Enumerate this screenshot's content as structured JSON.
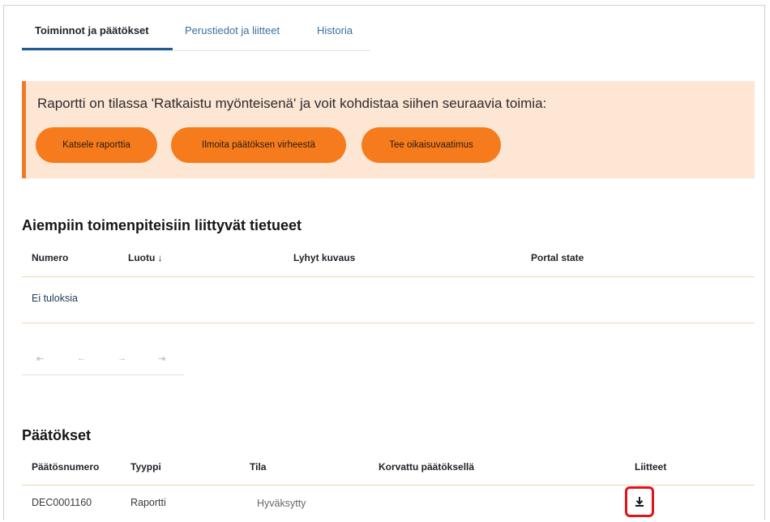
{
  "tabs": [
    {
      "label": "Toiminnot ja päätökset",
      "active": true
    },
    {
      "label": "Perustiedot ja liitteet",
      "active": false
    },
    {
      "label": "Historia",
      "active": false
    }
  ],
  "banner": {
    "text": "Raportti on tilassa 'Ratkaistu myönteisenä' ja voit kohdistaa siihen seuraavia toimia:",
    "buttons": [
      "Katsele raporttia",
      "Ilmoita päätöksen virheestä",
      "Tee oikaisuvaatimus"
    ]
  },
  "records": {
    "title": "Aiempiin toimenpiteisiin liittyvät tietueet",
    "columns": [
      "Numero",
      "Luotu ↓",
      "Lyhyt kuvaus",
      "Portal state"
    ],
    "empty_text": "Ei tuloksia"
  },
  "pagination": {
    "first": "⇤",
    "prev": "←",
    "next": "→",
    "last": "⇥"
  },
  "decisions": {
    "title": "Päätökset",
    "columns": [
      "Päätösnumero",
      "Tyyppi",
      "Tila",
      "Korvattu päätöksellä",
      "Liitteet"
    ],
    "rows": [
      {
        "number": "DEC0001160",
        "type": "Raportti",
        "status": "Hyväksytty",
        "replaced_by": ""
      }
    ]
  },
  "colors": {
    "accent": "#f57b1d",
    "banner_bg": "#fde6d4",
    "tab_active": "#1f5b94",
    "highlight": "#e0141b"
  },
  "icons": {
    "attachment": "download-icon"
  }
}
